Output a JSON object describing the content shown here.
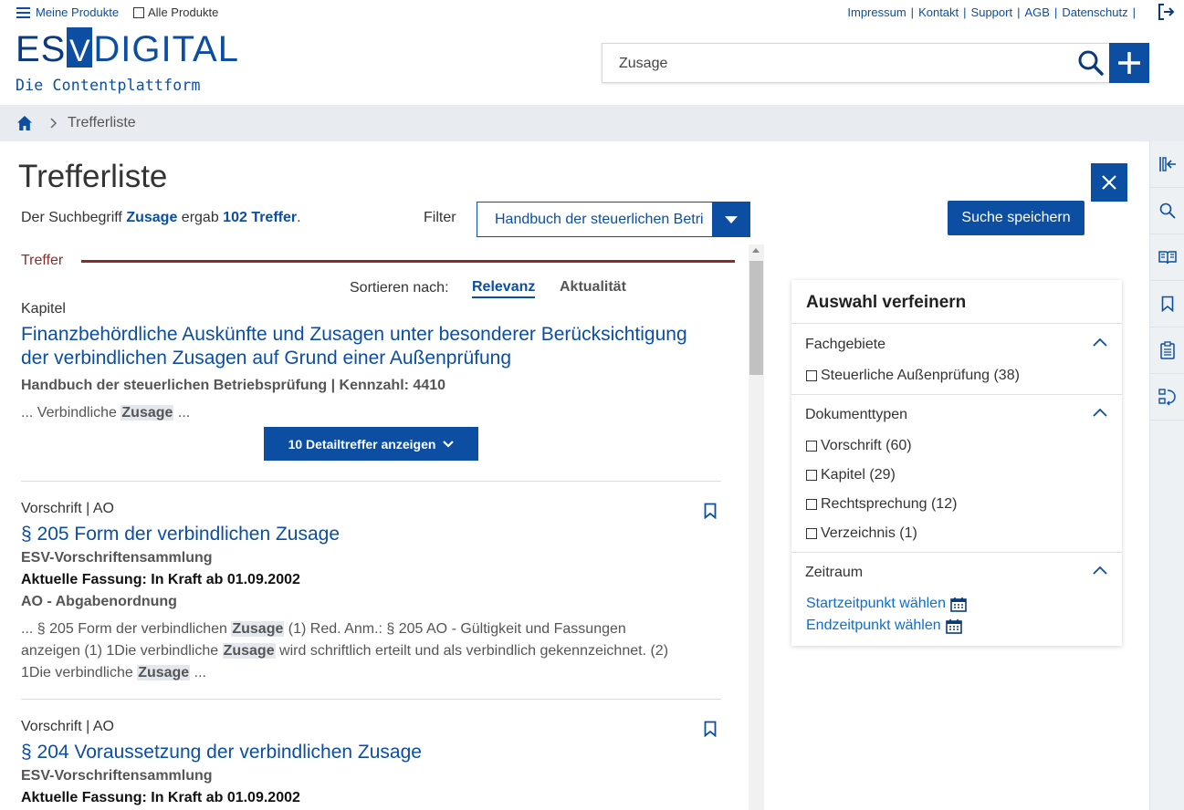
{
  "header": {
    "menu_label": "Meine Produkte",
    "all_products_label": "Alle Produkte",
    "top_links": [
      "Impressum",
      "Kontakt",
      "Support",
      "AGB",
      "Datenschutz"
    ],
    "logo": {
      "es": "ES",
      "v": "V",
      "digital": "DIGITAL",
      "tagline": "Die Contentplattform"
    },
    "search_value": "Zusage"
  },
  "breadcrumb": {
    "current": "Trefferliste"
  },
  "main": {
    "title": "Trefferliste",
    "summary_prefix": "Der Suchbegriff",
    "summary_term": "Zusage",
    "summary_mid": "ergab",
    "summary_count": "102 Treffer",
    "summary_suffix": ".",
    "filter_label": "Filter",
    "filter_value": "Handbuch der steuerlichen Betriebsprüfung",
    "save_search_label": "Suche speichern",
    "treffer_label": "Treffer",
    "sort_label": "Sortieren nach:",
    "sort_relevanz": "Relevanz",
    "sort_aktualitaet": "Aktualität"
  },
  "results": [
    {
      "type": "Kapitel",
      "title_line1": "Finanzbehördliche Auskünfte und Zusagen unter besonderer Berücksichtigung",
      "title_line2": "der verbindlichen Zusagen auf Grund einer Außenprüfung",
      "meta": "Handbuch der steuerlichen Betriebsprüfung | Kennzahl: 4410",
      "snippet_a": "... Verbindliche ",
      "snippet_hl": "Zusage",
      "snippet_b": " ...",
      "detail_button": "10 Detailtreffer anzeigen"
    },
    {
      "type": "Vorschrift | AO",
      "title": "§ 205 Form der verbindlichen Zusage",
      "meta1": "ESV-Vorschriftensammlung",
      "meta2": "Aktuelle Fassung: In Kraft ab 01.09.2002",
      "meta3": "AO - Abgabenordnung",
      "s1a": "... § 205 Form der verbindlichen ",
      "s1hl": "Zusage",
      "s1b": "  (1) Red. Anm.: § 205 AO -  Gültigkeit und Fassungen",
      "s2a": "anzeigen (1) 1Die verbindliche ",
      "s2hl": "Zusage",
      "s2b": " wird schriftlich erteilt und als verbindlich gekennzeichnet. (2)",
      "s3a": "1Die verbindliche ",
      "s3hl": "Zusage",
      "s3b": " ..."
    },
    {
      "type": "Vorschrift | AO",
      "title": "§ 204 Voraussetzung der verbindlichen Zusage",
      "meta1": "ESV-Vorschriftensammlung",
      "meta2": "Aktuelle Fassung: In Kraft ab 01.09.2002"
    }
  ],
  "refine": {
    "title": "Auswahl verfeinern",
    "fachgebiete_title": "Fachgebiete",
    "fachgebiete": [
      "Steuerliche Außenprüfung (38)"
    ],
    "dokumenttypen_title": "Dokumenttypen",
    "dokumenttypen": [
      "Vorschrift (60)",
      "Kapitel (29)",
      "Rechtsprechung (12)",
      "Verzeichnis (1)"
    ],
    "zeitraum_title": "Zeitraum",
    "start_label": "Startzeitpunkt wählen",
    "end_label": "Endzeitpunkt wählen"
  },
  "colors": {
    "primary": "#0b4ea2",
    "accent_red": "#8b2c2c",
    "rail_bg": "#eef1f4"
  },
  "rail_icons": [
    "collapse-panel-icon",
    "search-icon",
    "book-icon",
    "bookmark-icon",
    "clipboard-icon",
    "history-icon"
  ]
}
